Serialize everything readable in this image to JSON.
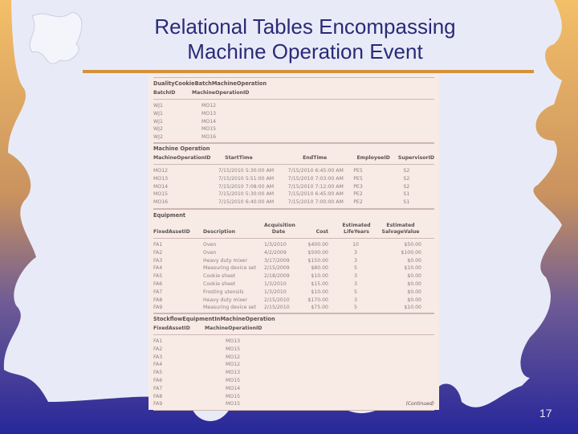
{
  "slide": {
    "title_line1": "Relational Tables Encompassing",
    "title_line2": "Machine Operation Event",
    "page_number": "17",
    "colors": {
      "title": "#2b2a78",
      "rule": "#d6913a",
      "bg_light": "#e8ebf7",
      "bg_orange": "#f2b763",
      "bg_blue": "#2a2a8a"
    }
  },
  "tables": {
    "t1": {
      "name": "DualityCookieBatchMachineOperation",
      "headers": [
        "BatchID",
        "MachineOperationID"
      ],
      "rows": [
        [
          "WJ1",
          "MO12"
        ],
        [
          "WJ1",
          "MO13"
        ],
        [
          "WJ1",
          "MO14"
        ],
        [
          "WJ2",
          "MO15"
        ],
        [
          "WJ2",
          "MO16"
        ]
      ]
    },
    "t2": {
      "name": "Machine Operation",
      "headers": [
        "MachineOperationID",
        "StartTime",
        "EndTime",
        "EmployeeID",
        "SupervisorID"
      ],
      "rows": [
        [
          "MO12",
          "7/15/2010 5:30:00 AM",
          "7/15/2010 6:45:00 AM",
          "PE5",
          "S2"
        ],
        [
          "MO13",
          "7/15/2010 5:51:00 AM",
          "7/15/2010 7:03:00 AM",
          "PE5",
          "S2"
        ],
        [
          "MO14",
          "7/15/2010 7:08:00 AM",
          "7/15/2010 7:12:00 AM",
          "PE3",
          "S2"
        ],
        [
          "MO15",
          "7/15/2010 5:30:00 AM",
          "7/15/2010 6:45:00 AM",
          "PE2",
          "S1"
        ],
        [
          "MO16",
          "7/15/2010 6:40:00 AM",
          "7/15/2010 7:00:00 AM",
          "PE2",
          "S1"
        ]
      ]
    },
    "t3": {
      "name": "Equipment",
      "headers": [
        "FixedAssetID",
        "Description",
        "Acquisition Date",
        "Cost",
        "Estimated LifeYears",
        "Estimated SalvageValue"
      ],
      "rows": [
        [
          "FA1",
          "Oven",
          "1/3/2010",
          "$400.00",
          "10",
          "$50.00"
        ],
        [
          "FA2",
          "Oven",
          "4/2/2009",
          "$500.00",
          "3",
          "$100.00"
        ],
        [
          "FA3",
          "Heavy duty mixer",
          "3/17/2009",
          "$150.00",
          "3",
          "$0.00"
        ],
        [
          "FA4",
          "Measuring device set",
          "2/15/2009",
          "$80.00",
          "5",
          "$10.00"
        ],
        [
          "FA5",
          "Cookie sheet",
          "2/18/2009",
          "$10.00",
          "3",
          "$0.00"
        ],
        [
          "FA6",
          "Cookie sheet",
          "1/3/2010",
          "$15.00",
          "3",
          "$0.00"
        ],
        [
          "FA7",
          "Frosting utensils",
          "1/3/2010",
          "$10.00",
          "5",
          "$0.00"
        ],
        [
          "FA8",
          "Heavy duty mixer",
          "2/15/2010",
          "$170.00",
          "3",
          "$0.00"
        ],
        [
          "FA9",
          "Measuring device set",
          "2/15/2010",
          "$75.00",
          "5",
          "$10.00"
        ]
      ]
    },
    "t4": {
      "name": "StockflowEquipmentInMachineOperation",
      "headers": [
        "FixedAssetID",
        "MachineOperationID"
      ],
      "rows": [
        [
          "FA1",
          "MO13"
        ],
        [
          "FA2",
          "MO15"
        ],
        [
          "FA3",
          "MO12"
        ],
        [
          "FA4",
          "MO12"
        ],
        [
          "FA5",
          "MO13"
        ],
        [
          "FA6",
          "MO15"
        ],
        [
          "FA7",
          "MO14"
        ],
        [
          "FA8",
          "MO15"
        ],
        [
          "FA9",
          "MO15"
        ]
      ]
    },
    "continued_label": "(Continued)"
  }
}
